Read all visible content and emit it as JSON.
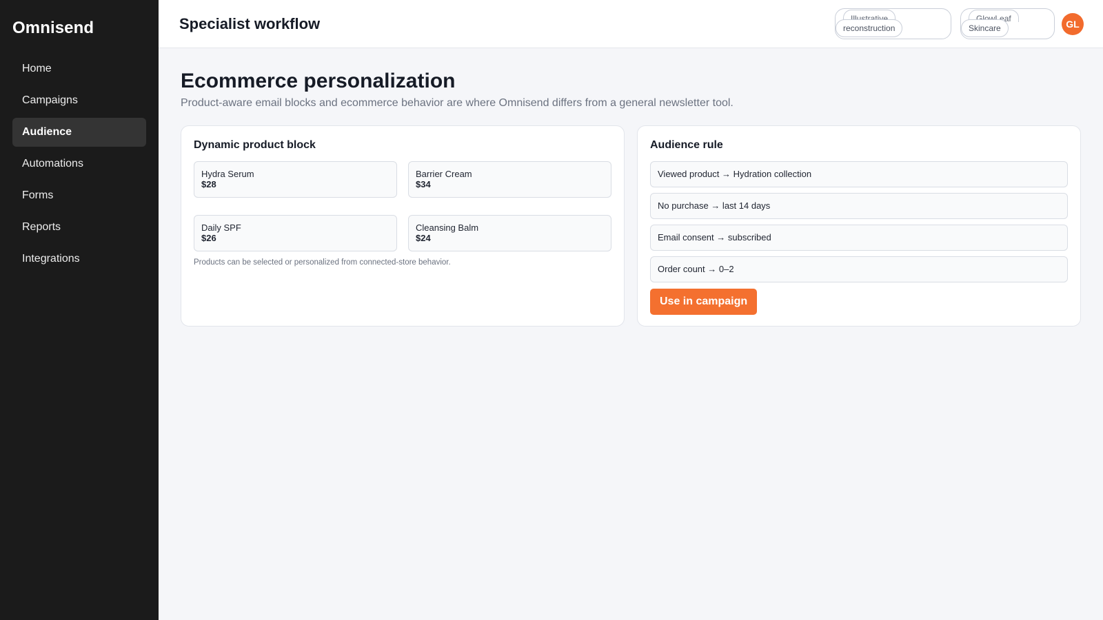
{
  "app": {
    "brand": "Omnisend"
  },
  "sidebar": {
    "items": [
      {
        "label": "Home"
      },
      {
        "label": "Campaigns"
      },
      {
        "label": "Audience",
        "active": true
      },
      {
        "label": "Automations"
      },
      {
        "label": "Forms"
      },
      {
        "label": "Reports"
      },
      {
        "label": "Integrations"
      }
    ]
  },
  "header": {
    "title": "Specialist workflow",
    "tags": [
      {
        "line1": "Illustrative",
        "line2": "reconstruction"
      },
      {
        "line1": "GlowLeaf",
        "line2": "Skincare"
      }
    ],
    "avatar_initials": "GL"
  },
  "main": {
    "title": "Ecommerce personalization",
    "subtitle": "Product-aware email blocks and ecommerce behavior are where Omnisend differs from a general newsletter tool.",
    "product_block": {
      "title": "Dynamic product block",
      "products": [
        {
          "name": "Hydra Serum",
          "price": "$28"
        },
        {
          "name": "Barrier Cream",
          "price": "$34"
        },
        {
          "name": "Daily SPF",
          "price": "$26"
        },
        {
          "name": "Cleansing Balm",
          "price": "$24"
        }
      ],
      "note": "Products can be selected or personalized from connected-store behavior."
    },
    "audience_rule": {
      "title": "Audience rule",
      "rules": [
        "Viewed product → Hydration collection",
        "No purchase → last 14 days",
        "Email consent → subscribed",
        "Order count → 0–2"
      ],
      "cta_label": "Use in campaign"
    }
  },
  "colors": {
    "accent": "#f4702f",
    "sidebar_bg": "#1b1b1b",
    "page_bg": "#f5f6f9"
  }
}
